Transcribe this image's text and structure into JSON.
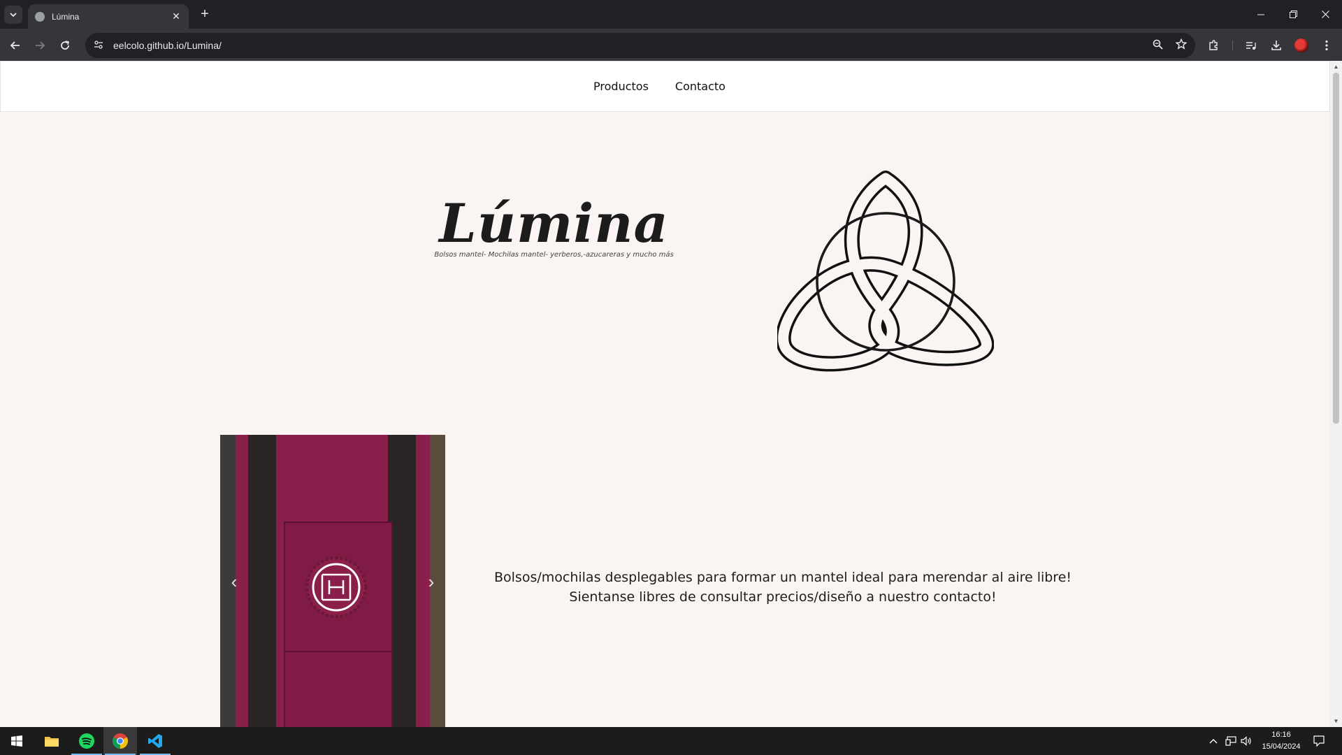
{
  "browser": {
    "tab_title": "Lúmina",
    "url": "eelcolo.github.io/Lumina/",
    "tab_close": "✕",
    "new_tab": "+"
  },
  "site": {
    "nav": [
      "Productos",
      "Contacto"
    ],
    "brand_title": "Lúmina",
    "brand_subtitle": "Bolsos mantel- Mochilas mantel- yerberos,-azucareras y mucho más",
    "description": "Bolsos/mochilas desplegables para formar un mantel ideal para merendar al aire libre! Sientanse libres de consultar precios/diseño a nuestro contacto!",
    "carousel_prev": "‹",
    "carousel_next": "›"
  },
  "taskbar": {
    "time": "16:16",
    "date": "15/04/2024"
  },
  "colors": {
    "page_bg": "#faf5f3",
    "bag_color": "#8a1f4c",
    "chrome_dark": "#202124",
    "chrome_toolbar": "#35363a"
  }
}
